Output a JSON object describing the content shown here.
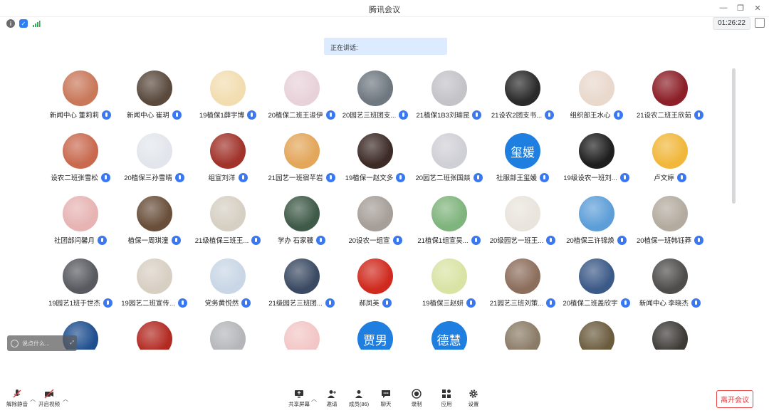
{
  "window": {
    "title": "腾讯会议"
  },
  "status": {
    "timer": "01:26:22"
  },
  "speaking_label": "正在讲话:",
  "participants": [
    {
      "name": "新闻中心 董莉莉",
      "avatar_color": "#c9785a"
    },
    {
      "name": "新闻中心 崔玥",
      "avatar_color": "#5a4a3e"
    },
    {
      "name": "19植保1薛宇博",
      "avatar_color": "#f2ddb0"
    },
    {
      "name": "20植保二班王浚伊",
      "avatar_color": "#e8d2d9"
    },
    {
      "name": "20园艺三班团支...",
      "avatar_color": "#6f7880"
    },
    {
      "name": "21植保1B3刘瑜昆",
      "avatar_color": "#c3c3c8"
    },
    {
      "name": "21设农2团支书...",
      "avatar_color": "#2a2a2a"
    },
    {
      "name": "组织部王水心",
      "avatar_color": "#e9d8cc"
    },
    {
      "name": "21设农二班王欣茹",
      "avatar_color": "#8c1f27"
    },
    {
      "name": "设农二班张雪松",
      "avatar_color": "#c96a4f"
    },
    {
      "name": "20植保三孙雪晴",
      "avatar_color": "#e2e6ec"
    },
    {
      "name": "组宣刘洋",
      "avatar_color": "#a1332b"
    },
    {
      "name": "21园艺一班宿芊岩",
      "avatar_color": "#e3a65a"
    },
    {
      "name": "19植保一赵文多",
      "avatar_color": "#3d2b27"
    },
    {
      "name": "20园艺二班张国燚",
      "avatar_color": "#cfcfd6"
    },
    {
      "name": "社服部王玺媛",
      "avatar_text": "玺媛"
    },
    {
      "name": "19级设农一班刘...",
      "avatar_color": "#1e1e1e"
    },
    {
      "name": "卢文婷",
      "avatar_color": "#f1b73b"
    },
    {
      "name": "社团部闫馨月",
      "avatar_color": "#e7b3b3"
    },
    {
      "name": "植保一周琪潼",
      "avatar_color": "#6a4f3b"
    },
    {
      "name": "21级植保三班王...",
      "avatar_color": "#d6cfc3"
    },
    {
      "name": "学办 石家骥",
      "avatar_color": "#3f5a48"
    },
    {
      "name": "20设农一组宣",
      "avatar_color": "#a69e98"
    },
    {
      "name": "21植保1组宣吴...",
      "avatar_color": "#7fb47c"
    },
    {
      "name": "20级园艺一班王...",
      "avatar_color": "#e9e4dc"
    },
    {
      "name": "20植保三许锦焕",
      "avatar_color": "#5d9ed8"
    },
    {
      "name": "20植保一班韩钰莽",
      "avatar_color": "#b3ab9f"
    },
    {
      "name": "19园艺1班于世杰",
      "avatar_color": "#585a60"
    },
    {
      "name": "19园艺二班宣传...",
      "avatar_color": "#d8cfc3"
    },
    {
      "name": "党务黄悦然",
      "avatar_color": "#c9d6e6"
    },
    {
      "name": "21级园艺三班团...",
      "avatar_color": "#3b4a63"
    },
    {
      "name": "郝凤英",
      "avatar_color": "#d02a1e"
    },
    {
      "name": "19植保三赵妍",
      "avatar_color": "#d9e3a4"
    },
    {
      "name": "21园艺三班刘策...",
      "avatar_color": "#8c6e5c"
    },
    {
      "name": "20植保二班盖欣宇",
      "avatar_color": "#3c5a88"
    },
    {
      "name": "新闻中心 李晓杰",
      "avatar_color": "#4e4d4c"
    },
    {
      "name": "",
      "avatar_color": "#1f4f8f"
    },
    {
      "name": "",
      "avatar_color": "#b22a22"
    },
    {
      "name": "",
      "avatar_color": "#b5b6b9"
    },
    {
      "name": "",
      "avatar_color": "#f3c6c6"
    },
    {
      "name": "",
      "avatar_text": "贾男"
    },
    {
      "name": "",
      "avatar_text": "德慧"
    },
    {
      "name": "",
      "avatar_color": "#8a7b66"
    },
    {
      "name": "",
      "avatar_color": "#6a5b3d"
    },
    {
      "name": "",
      "avatar_color": "#3d3a36"
    }
  ],
  "chat_placeholder": "说点什么...",
  "toolbar": {
    "mute": "解除静音",
    "video": "开启视频",
    "share": "共享屏幕",
    "invite": "邀请",
    "members": "成员(86)",
    "chat": "聊天",
    "record": "录制",
    "apps": "应用",
    "settings": "设置",
    "leave": "离开会议"
  },
  "colors": {
    "accent": "#3a78f2",
    "leave": "#e23b3b",
    "speaking_bg": "#dcebff"
  }
}
